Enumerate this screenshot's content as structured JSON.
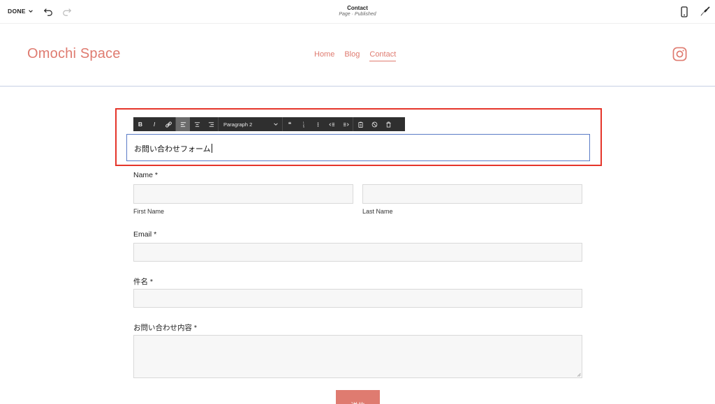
{
  "editor": {
    "done_label": "DONE",
    "page_title": "Contact",
    "page_status": "Page · Published"
  },
  "site": {
    "logo": "Omochi Space",
    "nav": [
      {
        "label": "Home"
      },
      {
        "label": "Blog"
      },
      {
        "label": "Contact",
        "active": true
      }
    ],
    "accent_color": "#df7b70"
  },
  "toolbar": {
    "bold": "B",
    "italic": "I",
    "paragraph_style": "Paragraph 2",
    "quote": "❝"
  },
  "text_block": {
    "value": "お問い合わせフォーム"
  },
  "form": {
    "name_label": "Name *",
    "first_name_label": "First Name",
    "last_name_label": "Last Name",
    "email_label": "Email *",
    "subject_label": "件名 *",
    "message_label": "お問い合わせ内容 *",
    "submit_label": "送信"
  },
  "colors": {
    "highlight": "#e5352a",
    "text_box_border": "#5a7bc6",
    "toolbar_bg": "#2f2f2f"
  }
}
